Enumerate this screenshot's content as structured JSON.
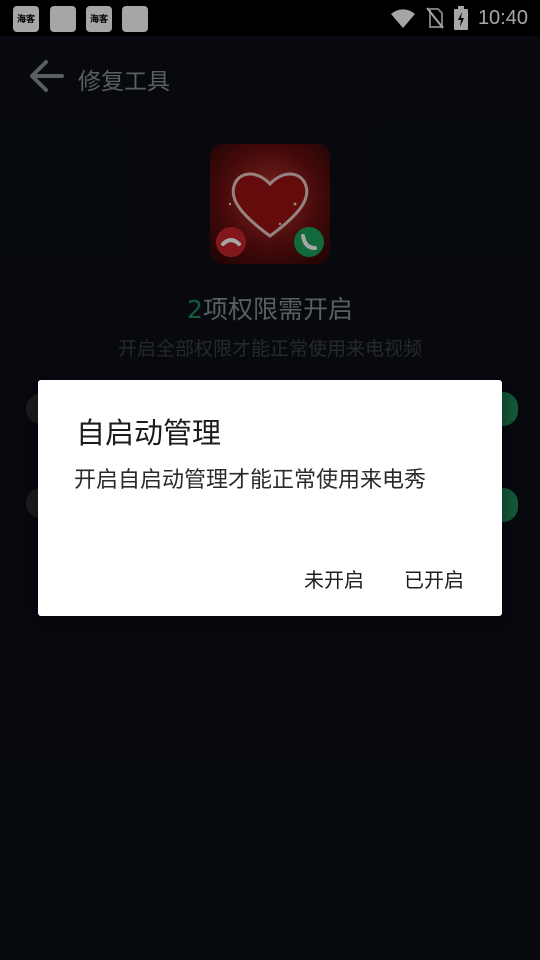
{
  "status_bar": {
    "time": "10:40",
    "notification_icons": [
      "海客",
      "",
      "海客",
      ""
    ]
  },
  "header": {
    "title": "修复工具"
  },
  "main": {
    "permission_count": "2",
    "permission_text": "项权限需开启",
    "subtitle": "开启全部权限才能正常使用来电视频"
  },
  "dialog": {
    "title": "自启动管理",
    "message": "开启自启动管理才能正常使用来电秀",
    "negative_label": "未开启",
    "positive_label": "已开启"
  },
  "colors": {
    "accent": "#1f8a5a",
    "background": "#0b0f17",
    "decline_red": "#c8262a",
    "accept_green": "#1aa45b"
  }
}
